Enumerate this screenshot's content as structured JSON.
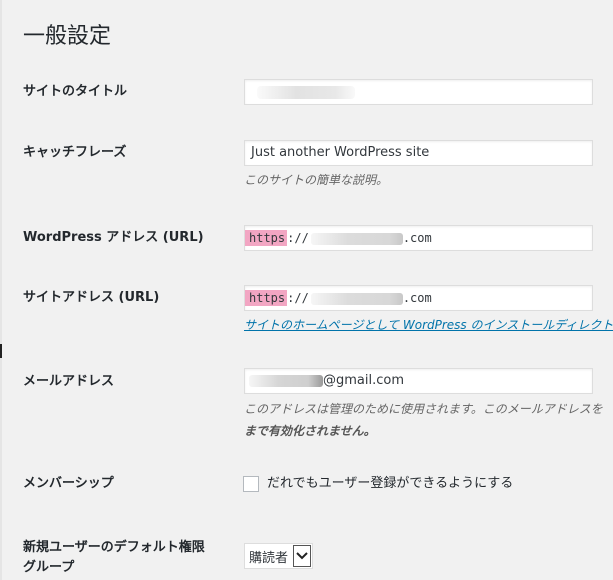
{
  "page_title": "一般設定",
  "site_title": {
    "label": "サイトのタイトル",
    "value": ""
  },
  "tagline": {
    "label": "キャッチフレーズ",
    "value": "Just another WordPress site",
    "description": "このサイトの簡単な説明。"
  },
  "wp_address": {
    "label": "WordPress アドレス (URL)",
    "protocol": "https",
    "separator": "://",
    "suffix": ".com"
  },
  "site_address": {
    "label": "サイトアドレス (URL)",
    "protocol": "https",
    "separator": "://",
    "suffix": ".com",
    "link_text": "サイトのホームページとして WordPress のインストールディレクト"
  },
  "email": {
    "label": "メールアドレス",
    "suffix": "@gmail.com",
    "description_line1": "このアドレスは管理のために使用されます。このメールアドレスを",
    "description_line2": "まで有効化されません。"
  },
  "membership": {
    "label": "メンバーシップ",
    "checkbox_label": "だれでもユーザー登録ができるようにする",
    "checked": false
  },
  "default_role": {
    "label_line1": "新規ユーザーのデフォルト権限",
    "label_line2": "グループ",
    "selected": "購読者"
  },
  "colors": {
    "background": "#f1f1f1",
    "link": "#0073aa",
    "protocol_highlight": "#f2a6c3"
  }
}
